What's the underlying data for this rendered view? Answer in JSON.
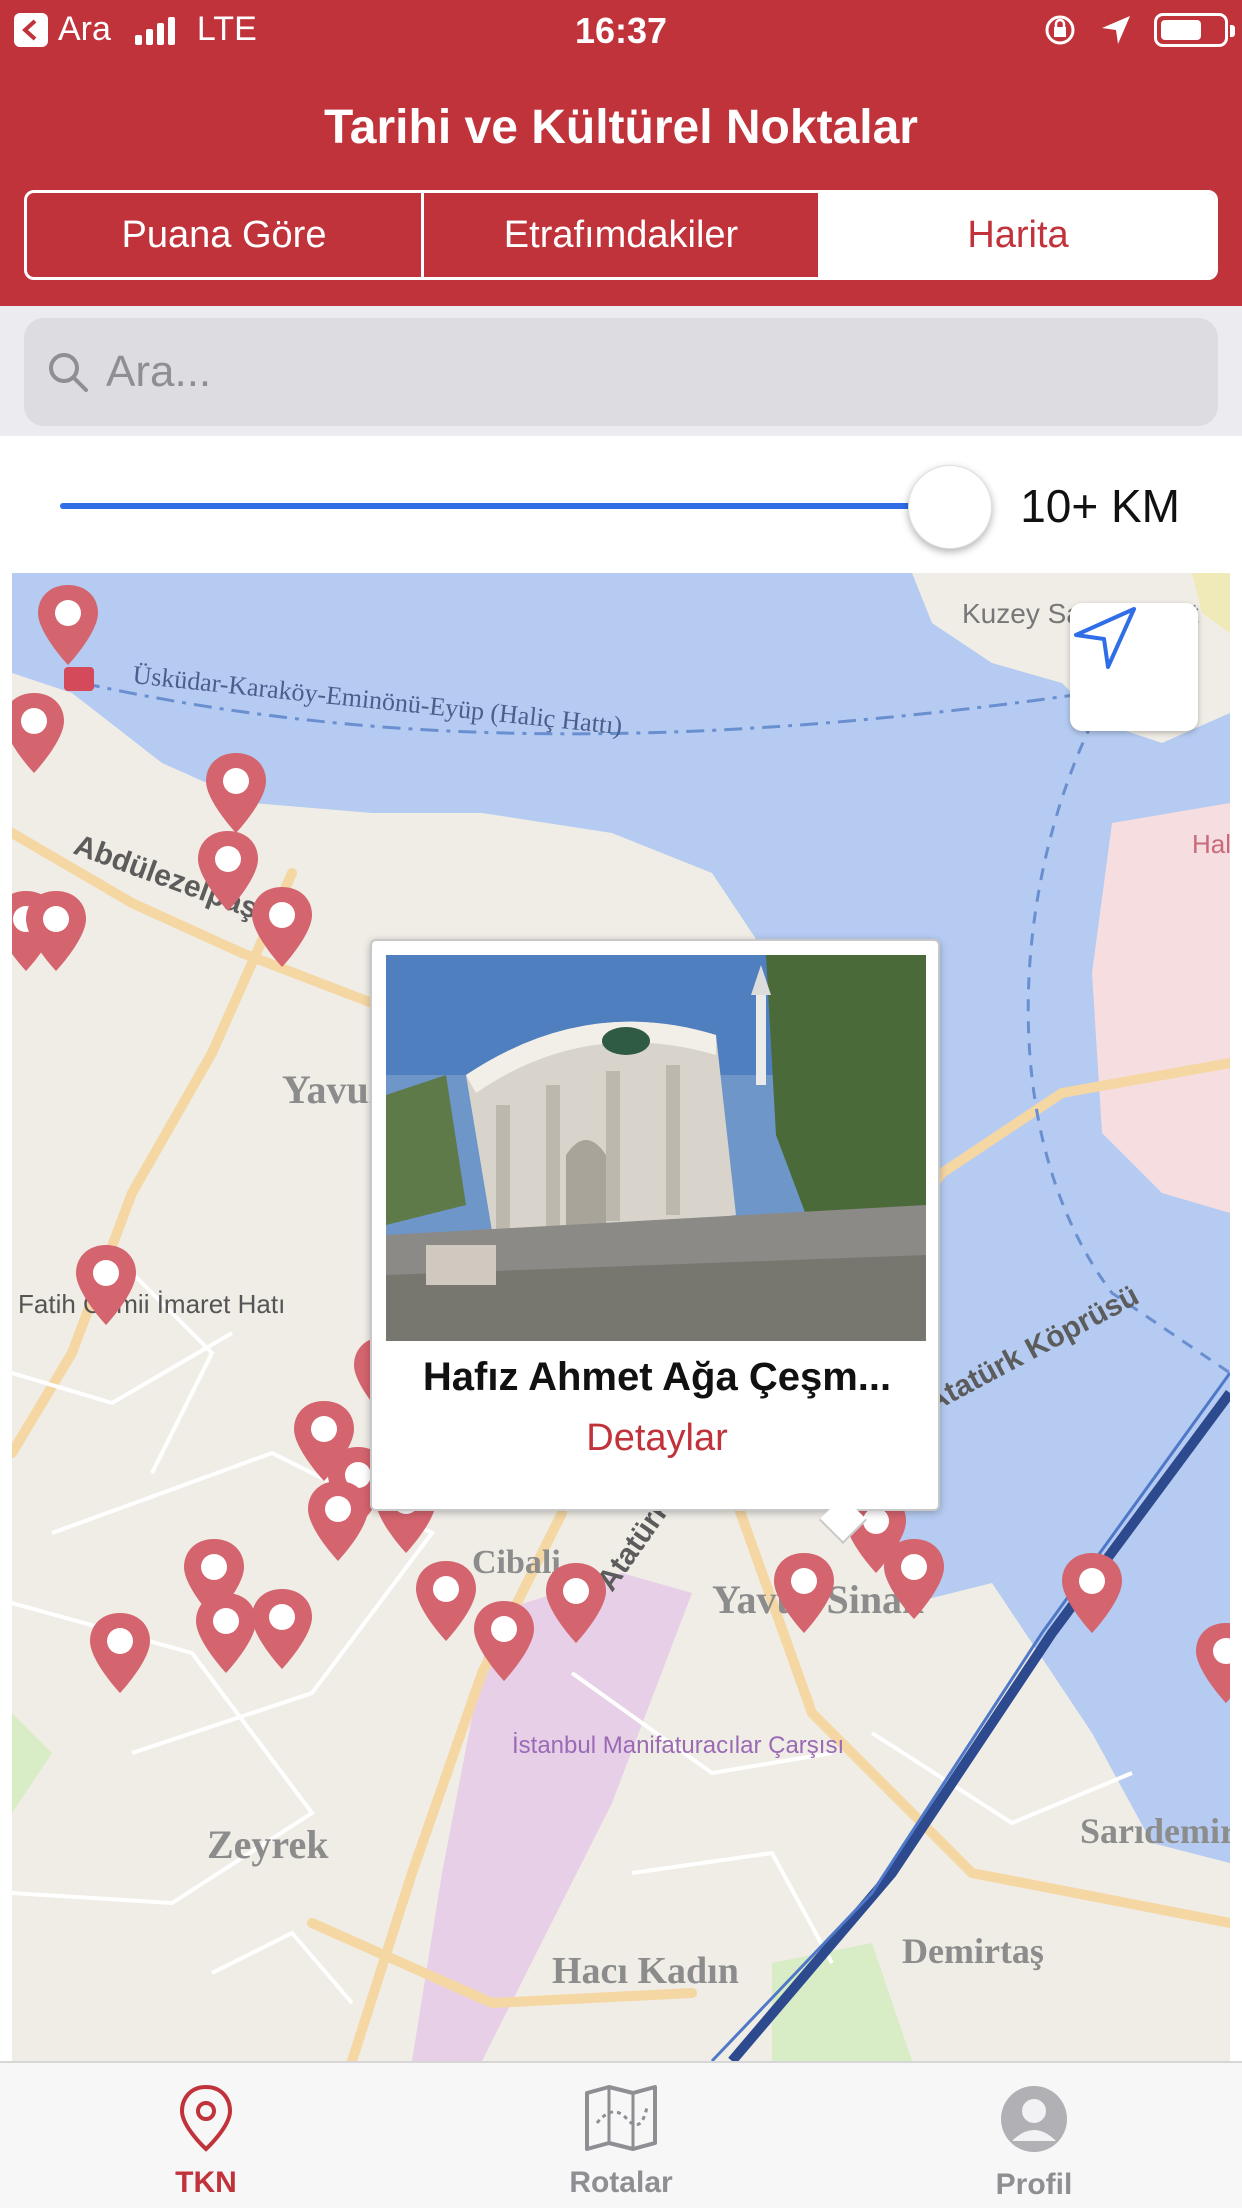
{
  "status_bar": {
    "back_label": "Ara",
    "network": "LTE",
    "time": "16:37"
  },
  "header": {
    "title": "Tarihi ve Kültürel Noktalar"
  },
  "tabs": [
    {
      "label": "Puana Göre",
      "active": false
    },
    {
      "label": "Etrafımdakiler",
      "active": false
    },
    {
      "label": "Harita",
      "active": true
    }
  ],
  "search": {
    "placeholder": "Ara..."
  },
  "distance": {
    "label": "10+ KM",
    "fraction": 1.0
  },
  "map": {
    "labels": [
      "Üsküdar-Karaköy-Eminönü-Eyüp (Haliç Hattı)",
      "Abdülezelpaşa",
      "Yavuz Sultan Selim",
      "Fatih Camii İmaret Hatı",
      "Yavuz Sinan",
      "Atatürk Bulvarı",
      "Atatürk Köprüsü",
      "Zeyrek",
      "İstanbul Manifaturacılar Çarşısı",
      "Hacı Kadın",
      "Sarıdemir",
      "Demirtaş",
      "Kuzey Sahil Komut",
      "Haliç Tersane",
      "Cibali"
    ],
    "popup": {
      "name": "Hafız Ahmet Ağa Çeşm...",
      "detail_label": "Detaylar"
    }
  },
  "tabbar": [
    {
      "label": "TKN",
      "icon": "map-pin-icon",
      "active": true
    },
    {
      "label": "Rotalar",
      "icon": "route-map-icon",
      "active": false
    },
    {
      "label": "Profil",
      "icon": "person-icon",
      "active": false
    }
  ],
  "colors": {
    "brand": "#c1333a",
    "accent": "#2f6ee6",
    "pin": "#d4646e",
    "water": "#b5cbf2"
  }
}
